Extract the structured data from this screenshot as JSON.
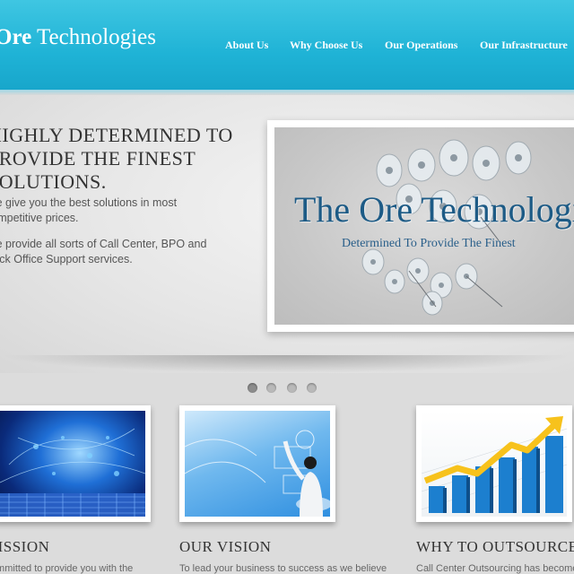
{
  "header": {
    "logo_bold": "Ore",
    "logo_rest": "Technologies",
    "nav": [
      "About Us",
      "Why Choose Us",
      "Our Operations",
      "Our Infrastructure"
    ]
  },
  "hero": {
    "title_lines": [
      "HIGHLY DETERMINED TO",
      "PROVIDE THE FINEST",
      "SOLUTIONS."
    ],
    "paragraph1_lines": [
      "We give you the best solutions in most",
      "competitive prices."
    ],
    "paragraph2_lines": [
      "We provide all sorts of Call Center, BPO and",
      "Back Office Support services."
    ],
    "banner_title": "The Ore Technologies",
    "banner_subtitle": "Determined To Provide The Finest",
    "slider_dots": 4,
    "active_dot": 0
  },
  "features": [
    {
      "title": "MISSION",
      "text": "Committed to provide you with the"
    },
    {
      "title": "OUR VISION",
      "text": "To lead your business to success as we believe"
    },
    {
      "title": "WHY TO OUTSOURCE",
      "text": "Call Center Outsourcing has become"
    }
  ],
  "colors": {
    "header": "#1fb3d6",
    "banner_text": "#1d5b86"
  }
}
